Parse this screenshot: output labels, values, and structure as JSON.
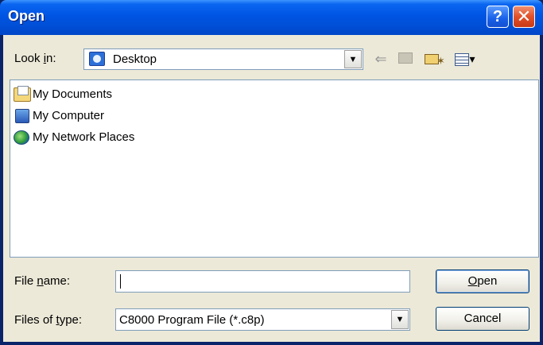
{
  "window": {
    "title": "Open"
  },
  "titlebar": {
    "help_label": "?",
    "close_label": "✕"
  },
  "toolbar": {
    "lookin_label_pre": "Look ",
    "lookin_label_accel": "i",
    "lookin_label_post": "n:",
    "lookin_value": "Desktop"
  },
  "files": [
    {
      "name": "My Documents",
      "icon": "my-documents-icon"
    },
    {
      "name": "My Computer",
      "icon": "my-computer-icon"
    },
    {
      "name": "My Network Places",
      "icon": "my-network-places-icon"
    }
  ],
  "form": {
    "filename_label_pre": "File ",
    "filename_label_accel": "n",
    "filename_label_post": "ame:",
    "filename_value": "",
    "filetype_label_pre": "Files of ",
    "filetype_label_accel": "t",
    "filetype_label_post": "ype:",
    "filetype_value": "C8000 Program File (*.c8p)"
  },
  "buttons": {
    "open_accel": "O",
    "open_rest": "pen",
    "cancel_label": "Cancel"
  }
}
